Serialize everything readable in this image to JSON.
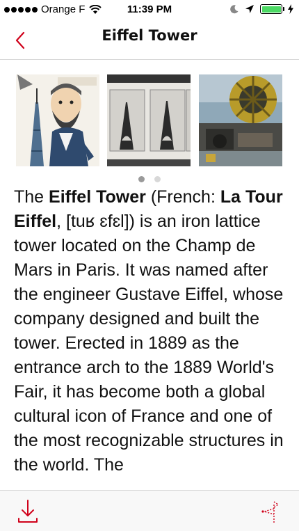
{
  "status_bar": {
    "carrier": "Orange F",
    "time": "11:39 PM",
    "battery_color": "#4cd964"
  },
  "nav": {
    "title": "Eiffel Tower",
    "accent_color": "#d0021b",
    "back_icon": "chevron-left-icon"
  },
  "gallery": {
    "images": [
      {
        "name": "caricature-image"
      },
      {
        "name": "tower-prints-image"
      },
      {
        "name": "machinery-image"
      }
    ],
    "page_count": 2,
    "current_page": 1
  },
  "article": {
    "p1": "The ",
    "b1": "Eiffel Tower",
    "p2": " (French: ",
    "b2": "La Tour Eiffel",
    "p3": ", [tuʁ ɛfɛl]) is an iron lattice tower located on the Champ de Mars in Paris. It was named after the engineer Gustave Eiffel, whose company designed and built the tower. Erected in 1889 as the entrance arch to the 1889 World's Fair, it has become both a global cultural icon of France and one of the most recognizable structures in the world. The"
  },
  "toolbar": {
    "download_icon": "download-icon",
    "share_icon": "map-pin-icon"
  }
}
